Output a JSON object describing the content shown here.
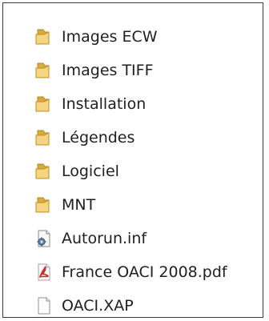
{
  "window": {
    "title": ""
  },
  "files": [
    {
      "name": "Images ECW",
      "type": "folder",
      "icon": "folder-icon"
    },
    {
      "name": "Images TIFF",
      "type": "folder",
      "icon": "folder-icon"
    },
    {
      "name": "Installation",
      "type": "folder",
      "icon": "folder-icon"
    },
    {
      "name": "Légendes",
      "type": "folder",
      "icon": "folder-icon"
    },
    {
      "name": "Logiciel",
      "type": "folder",
      "icon": "folder-icon"
    },
    {
      "name": "MNT",
      "type": "folder",
      "icon": "folder-icon"
    },
    {
      "name": "Autorun.inf",
      "type": "settings-file",
      "icon": "settings-file-icon"
    },
    {
      "name": "France OACI 2008.pdf",
      "type": "pdf-file",
      "icon": "pdf-file-icon"
    },
    {
      "name": "OACI.XAP",
      "type": "generic-file",
      "icon": "generic-file-icon"
    }
  ],
  "colors": {
    "folder_back": "#d7aa3e",
    "folder_front": "#f2cd67",
    "pdf_accent": "#d62828",
    "border": "#3a3a3a"
  }
}
